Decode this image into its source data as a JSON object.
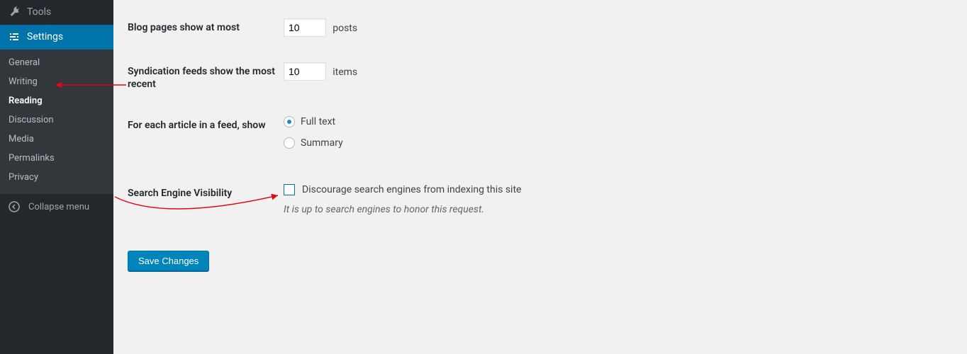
{
  "sidebar": {
    "tools_label": "Tools",
    "settings_label": "Settings",
    "submenu": [
      {
        "label": "General",
        "active": false
      },
      {
        "label": "Writing",
        "active": false
      },
      {
        "label": "Reading",
        "active": true
      },
      {
        "label": "Discussion",
        "active": false
      },
      {
        "label": "Media",
        "active": false
      },
      {
        "label": "Permalinks",
        "active": false
      },
      {
        "label": "Privacy",
        "active": false
      }
    ],
    "collapse_label": "Collapse menu"
  },
  "form": {
    "blog_pages": {
      "label": "Blog pages show at most",
      "value": "10",
      "suffix": "posts"
    },
    "syndication": {
      "label": "Syndication feeds show the most recent",
      "value": "10",
      "suffix": "items"
    },
    "article_feed": {
      "label": "For each article in a feed, show",
      "option1": "Full text",
      "option2": "Summary",
      "selected": "full"
    },
    "search_visibility": {
      "label": "Search Engine Visibility",
      "checkbox_label": "Discourage search engines from indexing this site",
      "description": "It is up to search engines to honor this request.",
      "checked": false
    },
    "save_button": "Save Changes"
  }
}
